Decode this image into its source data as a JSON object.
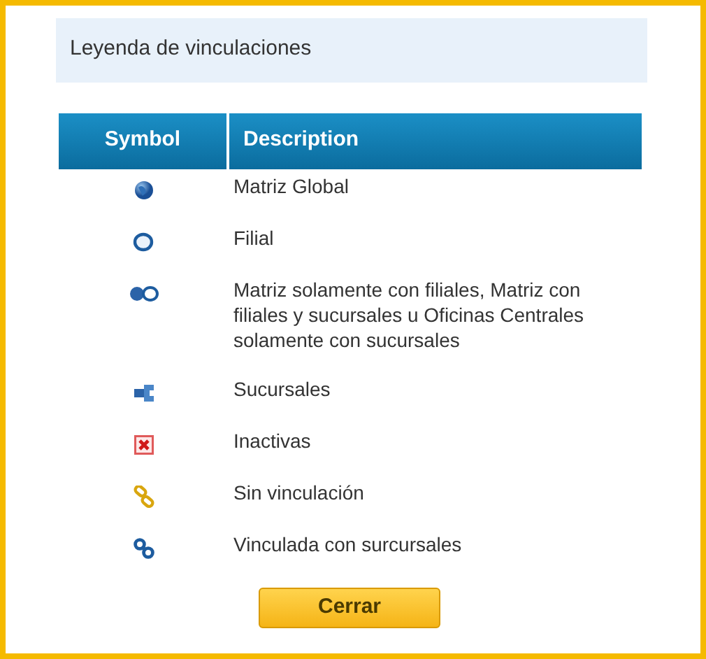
{
  "title": "Leyenda de vinculaciones",
  "table": {
    "columns": [
      "Symbol",
      "Description"
    ],
    "rows": [
      {
        "kind": "globe",
        "description": "Matriz Global"
      },
      {
        "kind": "ring",
        "description": "Filial"
      },
      {
        "kind": "globe-ring",
        "description": "Matriz solamente con filiales, Matriz con filiales y sucursales u Oficinas Centrales solamente con sucursales"
      },
      {
        "kind": "branch",
        "description": "Sucursales"
      },
      {
        "kind": "cross",
        "description": "Inactivas"
      },
      {
        "kind": "gold-link",
        "description": "Sin vinculación"
      },
      {
        "kind": "blue-link",
        "description": "Vinculada con surcursales"
      }
    ]
  },
  "button": "Cerrar"
}
